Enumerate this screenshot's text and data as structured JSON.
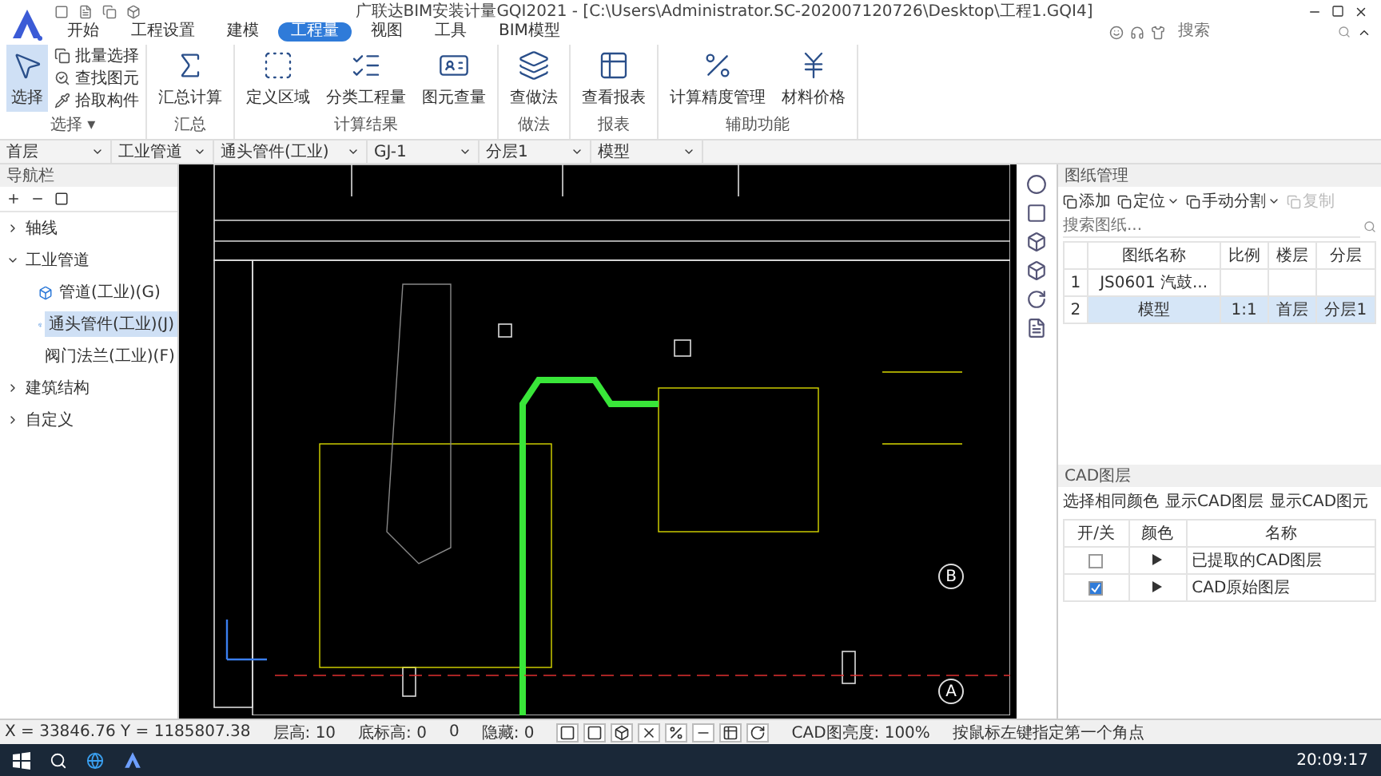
{
  "title_bar": {
    "title": "广联达BIM安装计量GQI2021 - [C:\\Users\\Administrator.SC-202007120726\\Desktop\\工程1.GQI4]"
  },
  "menu_tabs": [
    {
      "label": "开始",
      "selected": false
    },
    {
      "label": "工程设置",
      "selected": false
    },
    {
      "label": "建模",
      "selected": false
    },
    {
      "label": "工程量",
      "selected": true
    },
    {
      "label": "视图",
      "selected": false
    },
    {
      "label": "工具",
      "selected": false
    },
    {
      "label": "BIM模型",
      "selected": false
    }
  ],
  "search": {
    "placeholder": "搜索"
  },
  "ribbon_groups": [
    {
      "label": "选择 ▾",
      "items": [
        {
          "kind": "large",
          "label": "选择",
          "selected": true
        },
        {
          "kind": "small",
          "label": "批量选择"
        },
        {
          "kind": "small",
          "label": "查找图元"
        },
        {
          "kind": "small",
          "label": "拾取构件"
        }
      ]
    },
    {
      "label": "汇总",
      "items": [
        {
          "kind": "large",
          "label": "汇总计算",
          "selected": false
        }
      ]
    },
    {
      "label": "计算结果",
      "items": [
        {
          "kind": "large",
          "label": "定义区域",
          "selected": false
        },
        {
          "kind": "large",
          "label": "分类工程量",
          "selected": false
        },
        {
          "kind": "large",
          "label": "图元查量",
          "selected": false
        }
      ]
    },
    {
      "label": "做法",
      "items": [
        {
          "kind": "large",
          "label": "查做法",
          "selected": false
        }
      ]
    },
    {
      "label": "报表",
      "items": [
        {
          "kind": "large",
          "label": "查看报表",
          "selected": false
        }
      ]
    },
    {
      "label": "辅助功能",
      "items": [
        {
          "kind": "large",
          "label": "计算精度管理",
          "selected": false
        },
        {
          "kind": "large",
          "label": "材料价格",
          "selected": false
        }
      ]
    }
  ],
  "selectors": [
    "首层",
    "工业管道",
    "通头管件(工业)",
    "GJ-1",
    "分层1",
    "模型"
  ],
  "nav": {
    "title": "导航栏",
    "items": [
      {
        "label": "轴线",
        "expanded": false
      },
      {
        "label": "工业管道",
        "expanded": true,
        "children": [
          {
            "label": "管道(工业)(G)",
            "selected": false
          },
          {
            "label": "通头管件(工业)(J)",
            "selected": true
          },
          {
            "label": "阀门法兰(工业)(F)",
            "selected": false
          }
        ]
      },
      {
        "label": "建筑结构",
        "expanded": false
      },
      {
        "label": "自定义",
        "expanded": false
      }
    ]
  },
  "canvas": {
    "axis_labels": [
      "B",
      "A"
    ]
  },
  "drawing_panel": {
    "title": "图纸管理",
    "tools": [
      {
        "label": "添加",
        "disabled": false,
        "menu": false
      },
      {
        "label": "定位",
        "disabled": false,
        "menu": true
      },
      {
        "label": "手动分割",
        "disabled": false,
        "menu": true
      },
      {
        "label": "复制",
        "disabled": true,
        "menu": false
      }
    ],
    "search": {
      "placeholder": "搜索图纸..."
    },
    "columns": [
      "",
      "图纸名称",
      "比例",
      "楼层",
      "分层"
    ],
    "rows": [
      {
        "cells": [
          "1",
          "JS0601 汽鼓...",
          "",
          "",
          ""
        ],
        "selected": false
      },
      {
        "cells": [
          "2",
          "模型",
          "1:1",
          "首层",
          "分层1"
        ],
        "selected": true
      }
    ]
  },
  "cad_layers": {
    "title": "CAD图层",
    "tools": [
      "选择相同颜色",
      "显示CAD图层",
      "显示CAD图元"
    ],
    "columns": [
      "开/关",
      "颜色",
      "名称"
    ],
    "rows": [
      {
        "checked": false,
        "name": "已提取的CAD图层"
      },
      {
        "checked": true,
        "name": "CAD原始图层"
      }
    ]
  },
  "status_bar": {
    "coords": "X = 33846.76 Y = 1185807.38",
    "floor_height": "层高: 10",
    "base_elevation": "底标高: 0",
    "value": "0",
    "hidden": "隐藏: 0",
    "brightness": "CAD图亮度: 100%",
    "hint": "按鼠标左键指定第一个角点"
  },
  "taskbar": {
    "time": "20:09:17"
  }
}
